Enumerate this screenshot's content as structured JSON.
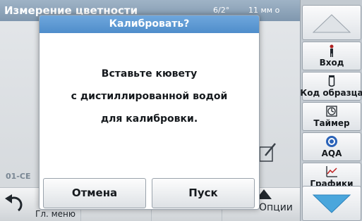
{
  "screen": {
    "title": "Измерение цветности",
    "temperature": "6/2°",
    "wavelength": "11 мм о",
    "program_id": "01-CE"
  },
  "bottom_bar": {
    "back_label": "Гл. меню",
    "options_label": "Опции"
  },
  "sidebar": {
    "items": [
      {
        "label": "Вход",
        "icon": "user-icon"
      },
      {
        "label": "Код образца",
        "icon": "vial-icon"
      },
      {
        "label": "Таймер",
        "icon": "timer-icon"
      },
      {
        "label": "AQA",
        "icon": "aqa-icon"
      },
      {
        "label": "Графики",
        "icon": "chart-icon"
      }
    ]
  },
  "dialog": {
    "title": "Калибровать?",
    "message_lines": [
      "Вставьте кювету",
      "с дистиллированной водой",
      "для калибровки."
    ],
    "cancel_label": "Отмена",
    "start_label": "Пуск"
  },
  "colors": {
    "dialog_title_bg": "#5b97d3",
    "title_bar_bg": "#8aa2b8",
    "sidebar_bg": "#c3cad1",
    "arrow_blue": "#4aa6dc"
  }
}
